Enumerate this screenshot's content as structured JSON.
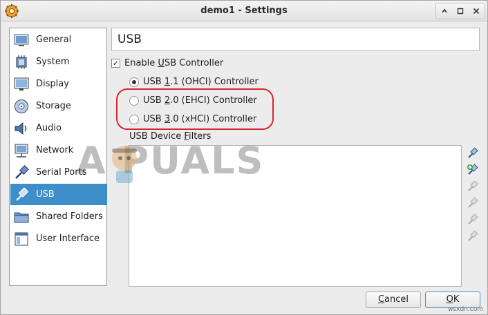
{
  "window": {
    "title": "demo1 - Settings",
    "icon": "virtualbox-gear-icon",
    "controls": [
      "restore-icon",
      "maximize-icon",
      "close-icon"
    ]
  },
  "sidebar": {
    "items": [
      {
        "label": "General",
        "icon": "general-icon"
      },
      {
        "label": "System",
        "icon": "system-chip-icon"
      },
      {
        "label": "Display",
        "icon": "monitor-icon"
      },
      {
        "label": "Storage",
        "icon": "disk-icon"
      },
      {
        "label": "Audio",
        "icon": "speaker-icon"
      },
      {
        "label": "Network",
        "icon": "network-icon"
      },
      {
        "label": "Serial Ports",
        "icon": "serial-port-icon"
      },
      {
        "label": "USB",
        "icon": "usb-icon",
        "selected": true
      },
      {
        "label": "Shared Folders",
        "icon": "folder-icon"
      },
      {
        "label": "User Interface",
        "icon": "user-interface-icon"
      }
    ]
  },
  "main": {
    "title": "USB",
    "enable_usb": {
      "label_pre": "Enable ",
      "label_accel": "U",
      "label_post": "SB Controller",
      "checked": true
    },
    "controllers": [
      {
        "pre": "USB ",
        "accel": "1",
        "post": ".1 (OHCI) Controller",
        "checked": true
      },
      {
        "pre": "USB ",
        "accel": "2",
        "post": ".0 (EHCI) Controller",
        "checked": false
      },
      {
        "pre": "USB ",
        "accel": "3",
        "post": ".0 (xHCI) Controller",
        "checked": false
      }
    ],
    "filters": {
      "pre": "USB Device ",
      "accel": "F",
      "post": "ilters"
    },
    "filter_tools": [
      "add-filter-icon",
      "add-from-device-icon",
      "edit-filter-icon",
      "remove-filter-icon",
      "move-up-icon",
      "move-down-icon"
    ],
    "highlight_color": "#d7262e"
  },
  "buttons": {
    "cancel": {
      "accel": "C",
      "rest": "ancel"
    },
    "ok": {
      "accel": "O",
      "rest": "K"
    }
  },
  "watermark": "A  PUALS",
  "site_mark": "wsxdn.com"
}
